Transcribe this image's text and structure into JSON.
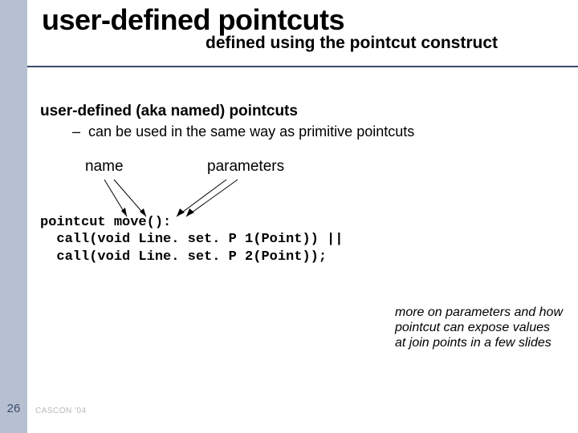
{
  "header": {
    "title": "user-defined pointcuts",
    "subtitle": "defined using the pointcut construct"
  },
  "section": {
    "heading": "user-defined (aka named) pointcuts",
    "bullet_dash": "–",
    "bullet_text": "can be used in the same way as primitive pointcuts",
    "label_name": "name",
    "label_params": "parameters"
  },
  "code": {
    "line1": "pointcut move():",
    "line2": "  call(void Line. set. P 1(Point)) ||",
    "line3": "  call(void Line. set. P 2(Point));"
  },
  "note": "more on parameters and how pointcut can expose values at join points in a few slides",
  "footer": {
    "page": "26",
    "credit": "CASCON '04"
  }
}
